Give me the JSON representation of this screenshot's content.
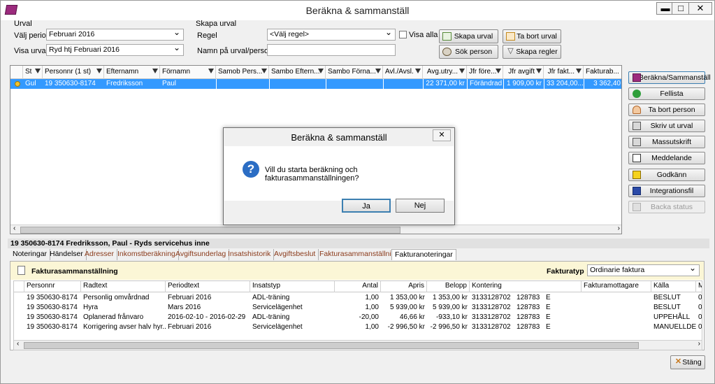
{
  "window": {
    "title": "Beräkna & sammanställ",
    "min_label": "▬",
    "max_label": "□",
    "close_label": "✕"
  },
  "urval": {
    "group_label": "Urval",
    "period_label": "Välj period",
    "period_value": "Februari 2016",
    "visa_label": "Visa urval",
    "visa_value": "Ryd htj  Februari 2016"
  },
  "skapa": {
    "group_label": "Skapa urval",
    "regel_label": "Regel",
    "regel_value": "<Välj regel>",
    "visa_alla_label": "Visa alla",
    "namn_label": "Namn på urval/personnr",
    "namn_value": "",
    "btn_skapa": "Skapa urval",
    "btn_ta_bort": "Ta bort urval",
    "btn_sok": "Sök person",
    "btn_regler": "Skapa regler"
  },
  "main_grid": {
    "columns": [
      "St",
      "Personnr (1 st)",
      "Efternamn",
      "Förnamn",
      "Samob Pers...",
      "Sambo Eftern...",
      "Sambo Förna...",
      "Avl./Avsl.",
      "Avg.utry...",
      "Jfr före...",
      "Jfr avgift",
      "Jfr fakt...",
      "Fakturab..."
    ],
    "rows": [
      {
        "st": "Gul",
        "personnr": "19 350630-8174",
        "efternamn": "Fredriksson",
        "fornamn": "Paul",
        "samob": "",
        "sambo_eft": "",
        "sambo_forn": "",
        "avl": "",
        "avg": "22 371,00 kr",
        "jfr_fore": "Förändrad",
        "jfr_avg": "1 909,00 kr",
        "jfr_fakt": "33 204,00...",
        "fakturab": "3 362,40"
      }
    ]
  },
  "side_buttons": [
    "Beräkna/Sammanställ",
    "Fellista",
    "Ta bort person",
    "Skriv ut urval",
    "Massutskrift",
    "Meddelande",
    "Godkänn",
    "Integrationsfil",
    "Backa status"
  ],
  "person_header": "19 350630-8174 Fredriksson, Paul  -  Ryds servicehus inne",
  "tabs": [
    "Noteringar",
    "Händelser",
    "Adresser",
    "Inkomstberäkning",
    "Avgiftsunderlag",
    "Insatshistorik",
    "Avgiftsbeslut",
    "Fakturasammanställning",
    "Fakturanoteringar"
  ],
  "invoice": {
    "title": "Fakturasammanställning",
    "type_label": "Fakturatyp",
    "type_value": "Ordinarie faktura",
    "columns": [
      "Personnr",
      "Radtext",
      "Periodtext",
      "Insatstyp",
      "Antal",
      "Apris",
      "Belopp",
      "Kontering",
      "",
      "",
      "Fakturamottagare",
      "Källa",
      "Mo"
    ],
    "rows": [
      [
        "19 350630-8174",
        "Personlig omvårdnad",
        "Februari 2016",
        "ADL-träning",
        "1,00",
        "1 353,00 kr",
        "1 353,00 kr",
        "3133128702",
        "128783",
        "E",
        "",
        "BESLUT",
        "0"
      ],
      [
        "19 350630-8174",
        "Hyra",
        "Mars 2016",
        "Servicelägenhet",
        "1,00",
        "5 939,00 kr",
        "5 939,00 kr",
        "3133128702",
        "128783",
        "E",
        "",
        "BESLUT",
        "0"
      ],
      [
        "19 350630-8174",
        "Oplanerad frånvaro",
        "2016-02-10 - 2016-02-29",
        "ADL-träning",
        "-20,00",
        "46,66 kr",
        "-933,10 kr",
        "3133128702",
        "128783",
        "E",
        "",
        "UPPEHÅLL",
        "0"
      ],
      [
        "19 350630-8174",
        "Korrigering avser halv hyr...",
        "Februari 2016",
        "Servicelägenhet",
        "1,00",
        "-2 996,50 kr",
        "-2 996,50 kr",
        "3133128702",
        "128783",
        "E",
        "",
        "MANUELLDEB",
        "0"
      ]
    ]
  },
  "close_button": "Stäng",
  "dialog": {
    "title": "Beräkna & sammanställ",
    "message": "Vill du starta beräkning och fakturasammanställningen?",
    "yes": "Ja",
    "no": "Nej",
    "close": "✕"
  }
}
